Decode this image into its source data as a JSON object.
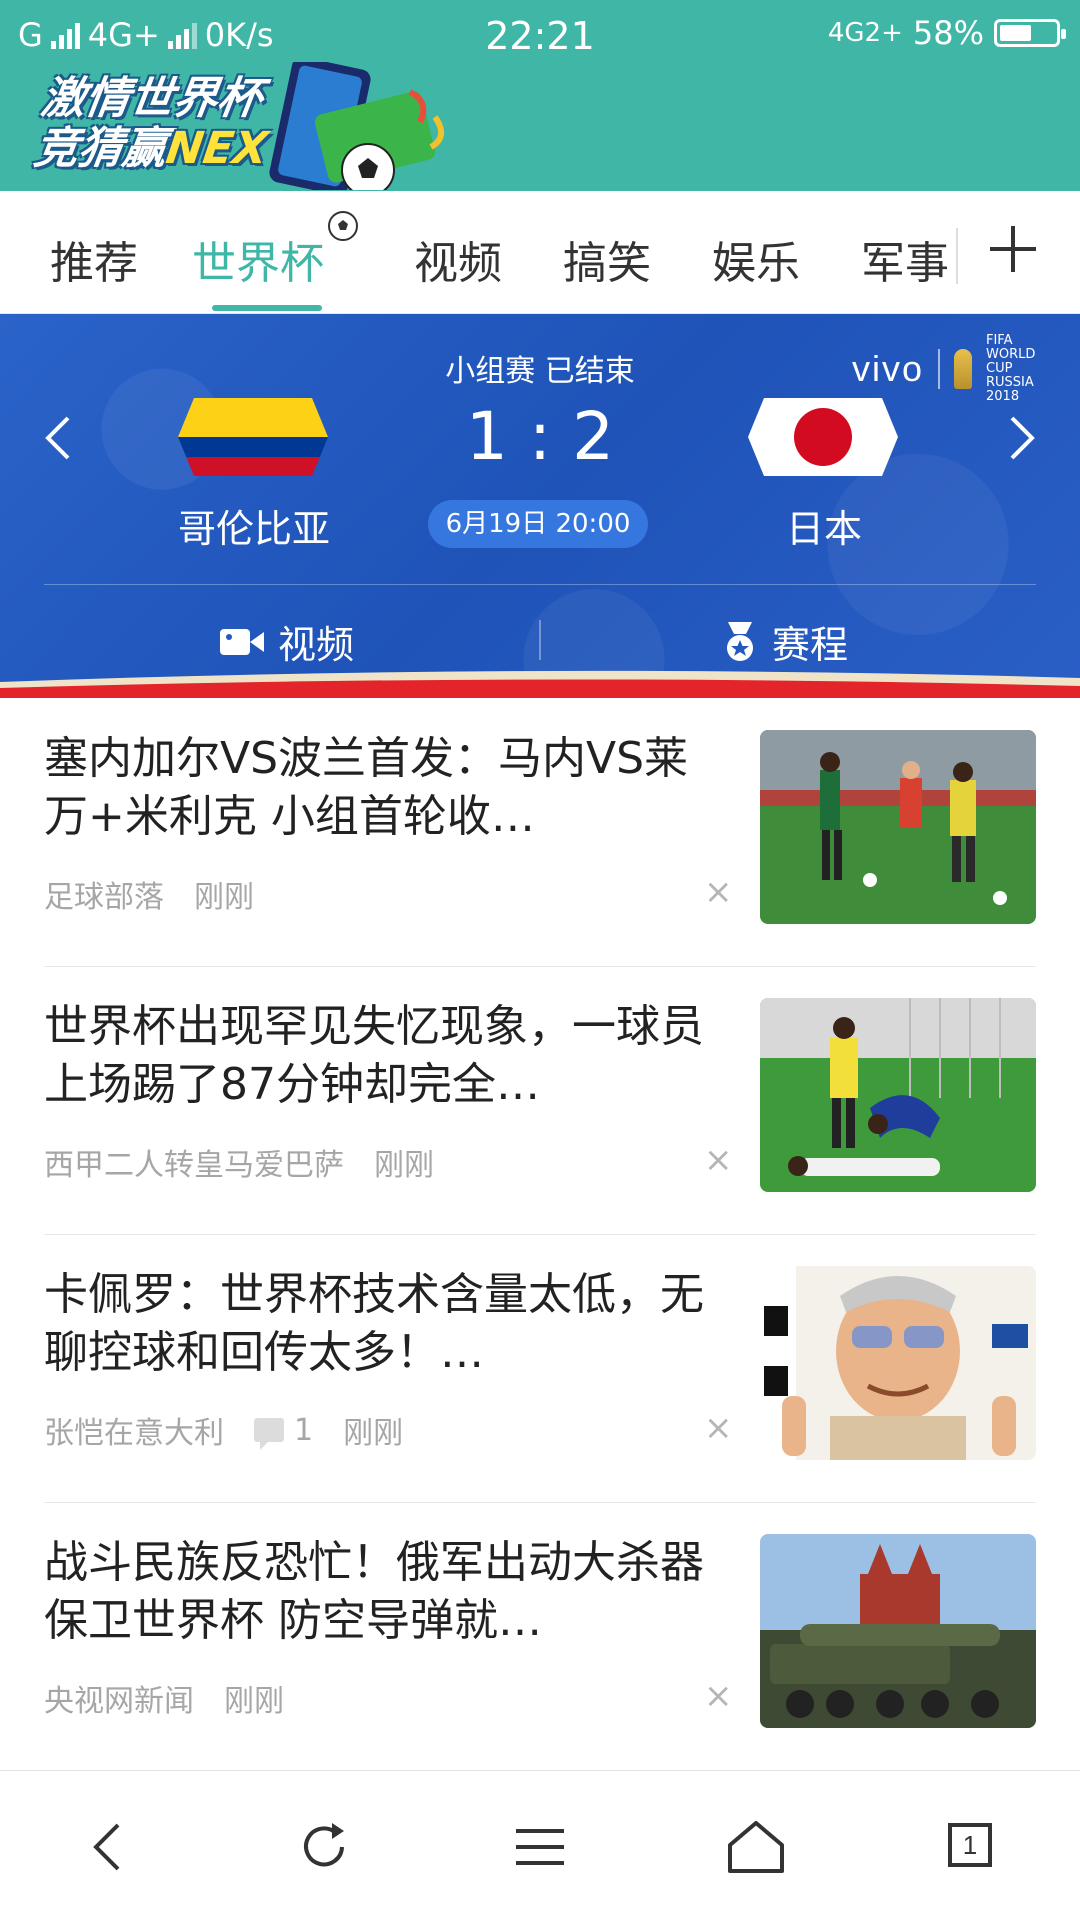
{
  "status": {
    "carrier": "G",
    "network": "4G+",
    "speed": "0K/s",
    "time": "22:21",
    "network_right": "4G2+",
    "battery_percent": "58%",
    "battery_level": 0.58
  },
  "banner": {
    "line1": "激情世界杯",
    "line2_prefix": "竞猜赢",
    "line2_brand": "NEX"
  },
  "tabs": [
    {
      "label": "推荐"
    },
    {
      "label": "世界杯"
    },
    {
      "label": "视频"
    },
    {
      "label": "搞笑"
    },
    {
      "label": "娱乐"
    },
    {
      "label": "军事"
    }
  ],
  "active_tab": "世界杯",
  "match": {
    "sponsor": "vivo",
    "cup_text": "FIFA WORLD CUP RUSSIA 2018",
    "stage": "小组赛 已结束",
    "home_team": "哥伦比亚",
    "away_team": "日本",
    "score": "1 : 2",
    "datetime": "6月19日 20:00",
    "video_label": "视频",
    "schedule_label": "赛程"
  },
  "news": [
    {
      "title": "塞内加尔VS波兰首发：马内VS莱万+米利克 小组首轮收…",
      "source": "足球部落",
      "time": "刚刚",
      "comments": ""
    },
    {
      "title": "世界杯出现罕见失忆现象，一球员上场踢了87分钟却完全…",
      "source": "西甲二人转皇马爱巴萨",
      "time": "刚刚",
      "comments": ""
    },
    {
      "title": "卡佩罗：世界杯技术含量太低，无聊控球和回传太多！…",
      "source": "张恺在意大利",
      "time": "刚刚",
      "comments": "1"
    },
    {
      "title": "战斗民族反恐忙！俄军出动大杀器保卫世界杯 防空导弹就…",
      "source": "央视网新闻",
      "time": "刚刚",
      "comments": ""
    }
  ],
  "dismiss_glyph": "×",
  "bottom_nav": {
    "tab_count": "1"
  },
  "colors": {
    "accent": "#3fb6a6",
    "match_bg": "#2258bf"
  }
}
